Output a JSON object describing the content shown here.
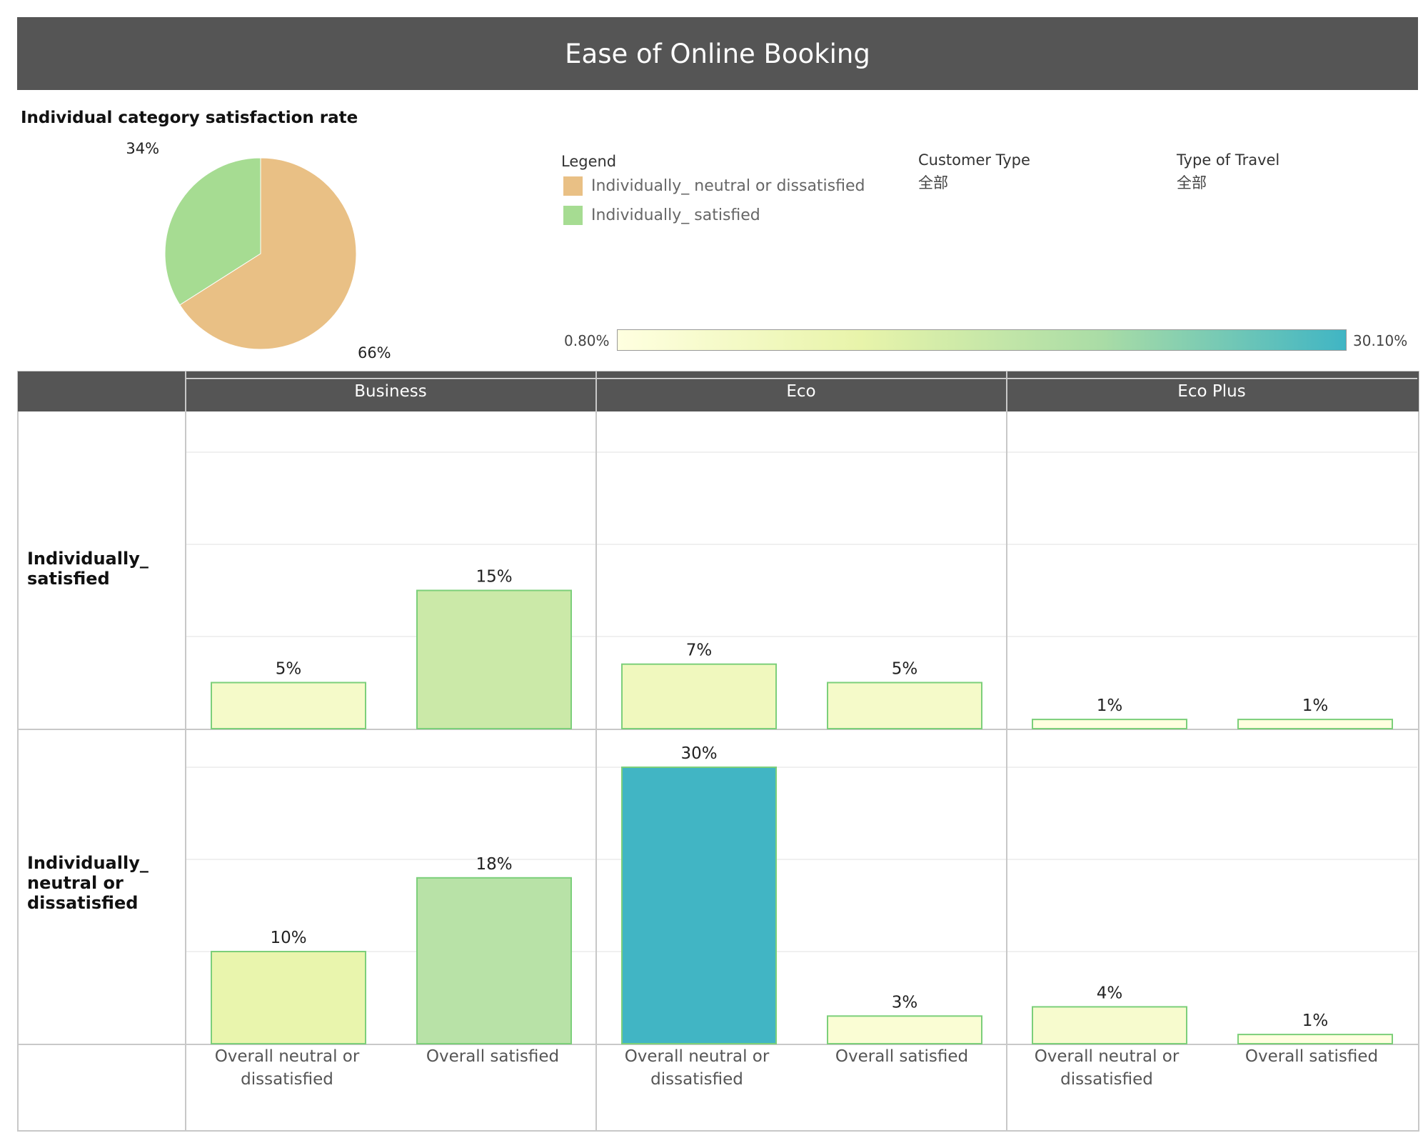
{
  "title": "Ease of Online Booking",
  "pie_title": "Individual category satisfaction rate",
  "legend": {
    "title": "Legend",
    "items": [
      {
        "label": "Individually_ neutral or dissatisfied",
        "color": "#e9c085"
      },
      {
        "label": "Individually_ satisfied",
        "color": "#a6dc92"
      }
    ]
  },
  "filters": [
    {
      "label": "Customer Type",
      "value": "全部"
    },
    {
      "label": "Type of Travel",
      "value": "全部"
    }
  ],
  "color_scale": {
    "min_label": "0.80%",
    "max_label": "30.10%",
    "min": 0.8,
    "max": 30.1,
    "colors": [
      "#ffffe0",
      "#e8f4aa",
      "#a9dca6",
      "#40b5c4"
    ]
  },
  "chart_data": [
    {
      "type": "pie",
      "title": "Individual category satisfaction rate",
      "slices": [
        {
          "name": "Individually_ neutral or dissatisfied",
          "value": 66,
          "label": "66%",
          "color": "#e9c085"
        },
        {
          "name": "Individually_ satisfied",
          "value": 34,
          "label": "34%",
          "color": "#a6dc92"
        }
      ]
    },
    {
      "type": "bar",
      "columns": [
        "Business",
        "Eco",
        "Eco Plus"
      ],
      "rows": [
        "Individually_ satisfied",
        "Individually_ neutral or dissatisfied"
      ],
      "categories": [
        "Overall neutral or dissatisfied",
        "Overall satisfied"
      ],
      "ylim": [
        0,
        30
      ],
      "cells": [
        {
          "row": 0,
          "col": 0,
          "values": [
            5,
            15
          ],
          "labels": [
            "5%",
            "15%"
          ]
        },
        {
          "row": 0,
          "col": 1,
          "values": [
            7,
            5
          ],
          "labels": [
            "7%",
            "5%"
          ]
        },
        {
          "row": 0,
          "col": 2,
          "values": [
            1,
            1
          ],
          "labels": [
            "1%",
            "1%"
          ]
        },
        {
          "row": 1,
          "col": 0,
          "values": [
            10,
            18
          ],
          "labels": [
            "10%",
            "18%"
          ]
        },
        {
          "row": 1,
          "col": 1,
          "values": [
            30,
            3
          ],
          "labels": [
            "30%",
            "3%"
          ]
        },
        {
          "row": 1,
          "col": 2,
          "values": [
            4,
            1
          ],
          "labels": [
            "4%",
            "1%"
          ]
        }
      ],
      "grid": true
    }
  ],
  "row_headers": [
    [
      "Individually_",
      "satisfied"
    ],
    [
      "Individually_",
      "neutral or",
      "dissatisfied"
    ]
  ],
  "x_labels": [
    [
      "Overall neutral or",
      "dissatisfied"
    ],
    [
      "Overall satisfied"
    ]
  ]
}
